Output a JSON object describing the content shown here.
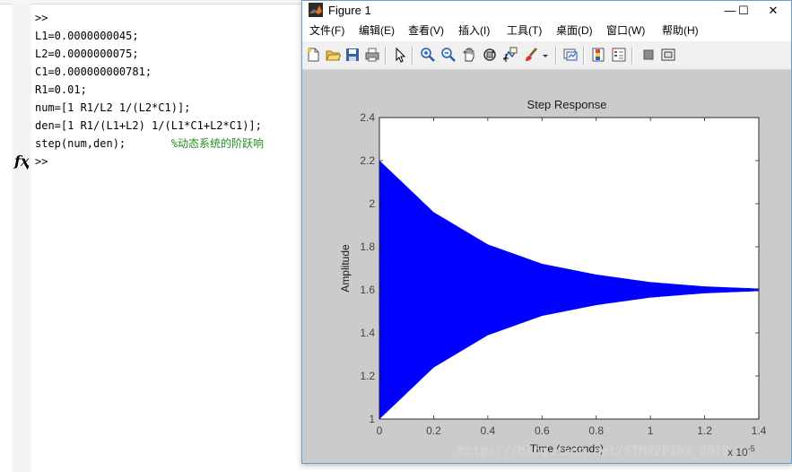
{
  "command_window": {
    "lines": [
      ">>",
      "L1=0.0000000045;",
      "L2=0.0000000075;",
      "C1=0.000000000781;",
      "R1=0.01;",
      "num=[1 R1/L2 1/(L2*C1)];",
      "den=[1 R1/(L1+L2) 1/(L1*C1+L2*C1)];",
      "step(num,den);"
    ],
    "comment": "%动态系统的阶跃响",
    "prompt": ">>",
    "fx_label": "fx"
  },
  "figure": {
    "title": "Figure 1",
    "controls": {
      "minimize": "—",
      "maximize": "☐",
      "close": "✕"
    },
    "menu": [
      "文件(F)",
      "编辑(E)",
      "查看(V)",
      "插入(I)",
      "工具(T)",
      "桌面(D)",
      "窗口(W)",
      "帮助(H)"
    ],
    "toolbar_icons": [
      "new-figure-icon",
      "open-icon",
      "save-icon",
      "print-icon",
      "edit-pointer-icon",
      "zoom-in-icon",
      "zoom-out-icon",
      "pan-icon",
      "rotate-3d-icon",
      "data-cursor-icon",
      "brush-icon",
      "link-plot-icon",
      "colorbar-icon",
      "legend-icon",
      "hide-plot-tools-icon",
      "show-plot-tools-icon"
    ]
  },
  "chart_data": {
    "type": "line",
    "title": "Step Response",
    "xlabel": "Time (seconds)",
    "ylabel": "Amplitude",
    "x_exponent": "x 10",
    "x_exponent_power": "-5",
    "xlim": [
      0,
      1.4
    ],
    "ylim": [
      1,
      2.4
    ],
    "xticks": [
      "0",
      "0.2",
      "0.4",
      "0.6",
      "0.8",
      "1",
      "1.2",
      "1.4"
    ],
    "yticks": [
      "1",
      "1.2",
      "1.4",
      "1.6",
      "1.8",
      "2",
      "2.2",
      "2.4"
    ],
    "grid": false,
    "series": [
      {
        "color": "#0000ff",
        "final_value": 1.6,
        "envelope_upper": [
          [
            0,
            2.2
          ],
          [
            0.2,
            1.96
          ],
          [
            0.4,
            1.81
          ],
          [
            0.6,
            1.72
          ],
          [
            0.8,
            1.67
          ],
          [
            1.0,
            1.635
          ],
          [
            1.2,
            1.615
          ],
          [
            1.4,
            1.605
          ]
        ],
        "envelope_lower": [
          [
            0,
            1.0
          ],
          [
            0.2,
            1.24
          ],
          [
            0.4,
            1.39
          ],
          [
            0.6,
            1.48
          ],
          [
            0.8,
            1.53
          ],
          [
            1.0,
            1.565
          ],
          [
            1.2,
            1.585
          ],
          [
            1.4,
            1.595
          ]
        ]
      }
    ]
  },
  "watermark": "https://blog.csdn.net/STM32F10x_2018"
}
